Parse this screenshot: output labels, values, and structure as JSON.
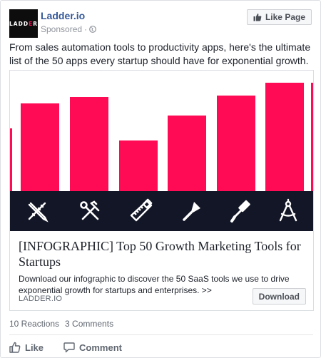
{
  "post": {
    "page_name": "Ladder.io",
    "logo_text_left": "LADD",
    "logo_text_accent": "E",
    "logo_text_right": "R",
    "sponsored_label": "Sponsored",
    "separator": "·",
    "like_page_label": "Like Page",
    "text": "From sales automation tools to productivity apps, here's the ultimate list of the 50 apps every startup should have for exponential growth."
  },
  "attachment": {
    "bar_color": "#ff0a54",
    "strip_color": "#121626",
    "bar_levels": [
      0.73,
      0.78,
      0.42,
      0.63,
      0.79,
      0.9,
      0.52
    ],
    "tool_icons": [
      "pencil-ruler-icon",
      "hammer-wrench-icon",
      "saw-icon",
      "trowel-icon",
      "paint-roller-icon",
      "compass-icon"
    ],
    "title": "[INFOGRAPHIC] Top 50 Growth Marketing Tools for Startups",
    "description": "Download our infographic to discover the 50 SaaS tools we use to drive exponential growth for startups and enterprises. >>",
    "domain": "LADDER.IO",
    "cta_label": "Download"
  },
  "engagement": {
    "reactions": "10 Reactions",
    "comments": "3 Comments"
  },
  "actions": {
    "like_label": "Like",
    "comment_label": "Comment"
  },
  "colors": {
    "link_blue": "#365899",
    "muted": "#90949c",
    "brand_pink": "#ff0a54"
  }
}
